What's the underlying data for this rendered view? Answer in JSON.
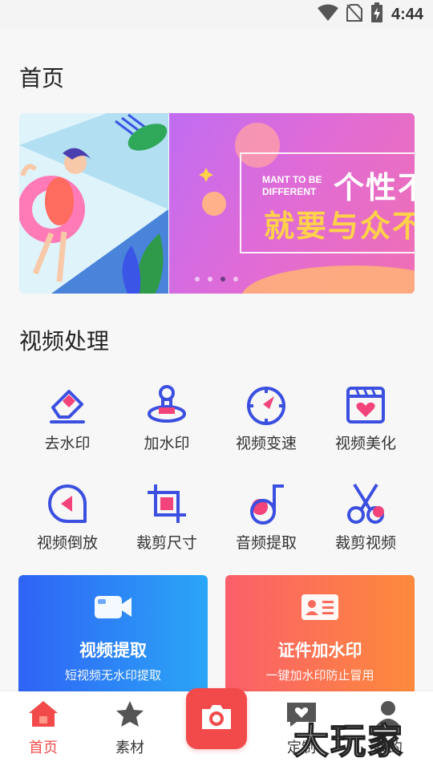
{
  "status_bar": {
    "time": "4:44",
    "icons": [
      "wifi-icon",
      "no-sim-icon",
      "battery-charging-icon"
    ]
  },
  "page_title": "首页",
  "banner": {
    "small_text": "MANT TO BE DIFFERENT",
    "big_line1": "个性不",
    "big_line2": "就要与众不",
    "page_count": 4,
    "active_index": 2
  },
  "section_title": "视频处理",
  "tools": [
    {
      "label": "去水印",
      "icon": "eraser-icon"
    },
    {
      "label": "加水印",
      "icon": "stamp-icon"
    },
    {
      "label": "视频变速",
      "icon": "speedometer-icon"
    },
    {
      "label": "视频美化",
      "icon": "clapperboard-heart-icon"
    },
    {
      "label": "视频倒放",
      "icon": "reverse-play-icon"
    },
    {
      "label": "裁剪尺寸",
      "icon": "crop-icon"
    },
    {
      "label": "音频提取",
      "icon": "music-note-icon"
    },
    {
      "label": "裁剪视频",
      "icon": "scissors-icon"
    }
  ],
  "cards": [
    {
      "title": "视频提取",
      "subtitle": "短视频无水印提取",
      "icon": "video-camera-icon"
    },
    {
      "title": "证件加水印",
      "subtitle": "一键加水印防止冒用",
      "icon": "id-card-icon"
    }
  ],
  "tabbar": {
    "items": [
      {
        "label": "首页",
        "icon": "home-icon",
        "active": true
      },
      {
        "label": "素材",
        "icon": "star-icon",
        "active": false
      },
      {
        "label": "",
        "icon": "camera-icon",
        "active": false
      },
      {
        "label": "定制",
        "icon": "chat-heart-icon",
        "active": false
      },
      {
        "label": "我的",
        "icon": "user-icon",
        "active": false
      }
    ]
  },
  "watermark": "大玩家",
  "colors": {
    "accent": "#f24a4a",
    "icon_blue": "#3b4fe0",
    "icon_pink": "#f2437a"
  }
}
